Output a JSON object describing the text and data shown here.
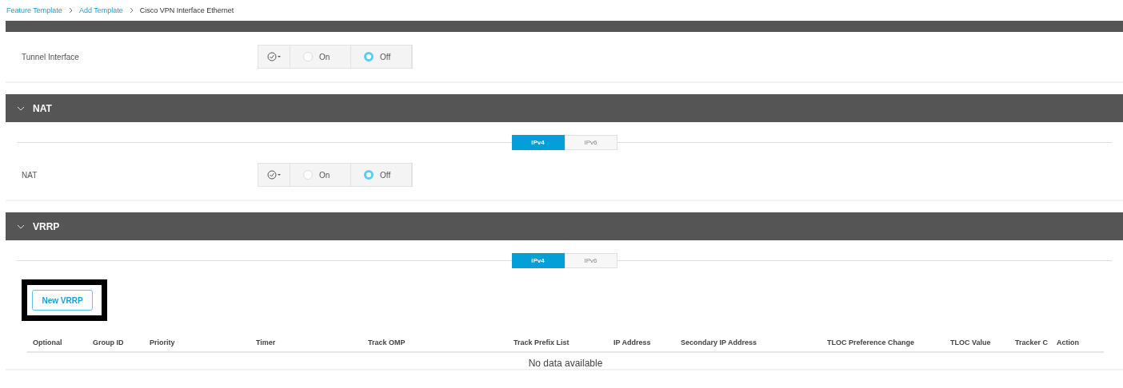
{
  "breadcrumb": [
    {
      "label": "Feature Template",
      "link": true
    },
    {
      "label": "Add Template",
      "link": true
    },
    {
      "label": "Cisco VPN Interface Ethernet",
      "link": false
    }
  ],
  "sections": [
    {
      "expanded": true,
      "fields": [
        {
          "label": "Tunnel Interface",
          "options": [
            {
              "label": "On",
              "selected": false
            },
            {
              "label": "Off",
              "selected": true
            }
          ]
        }
      ]
    },
    {
      "title": "NAT",
      "expanded": true,
      "tabs": [
        {
          "label": "IPv4",
          "selected": true
        },
        {
          "label": "IPv6",
          "selected": false
        }
      ],
      "fields": [
        {
          "label": "NAT",
          "options": [
            {
              "label": "On",
              "selected": false
            },
            {
              "label": "Off",
              "selected": true
            }
          ]
        }
      ]
    },
    {
      "title": "VRRP",
      "expanded": true,
      "tabs": [
        {
          "label": "IPv4",
          "selected": true
        },
        {
          "label": "IPv6",
          "selected": false
        }
      ],
      "button": "New VRRP",
      "table": {
        "columns": [
          "Optional",
          "Group ID",
          "Priority",
          "Timer",
          "Track OMP",
          "Track Prefix List",
          "IP Address",
          "Secondary IP Address",
          "TLOC Preference Change",
          "TLOC Value",
          "Tracker C",
          "Action"
        ],
        "empty": "No data available"
      }
    }
  ]
}
